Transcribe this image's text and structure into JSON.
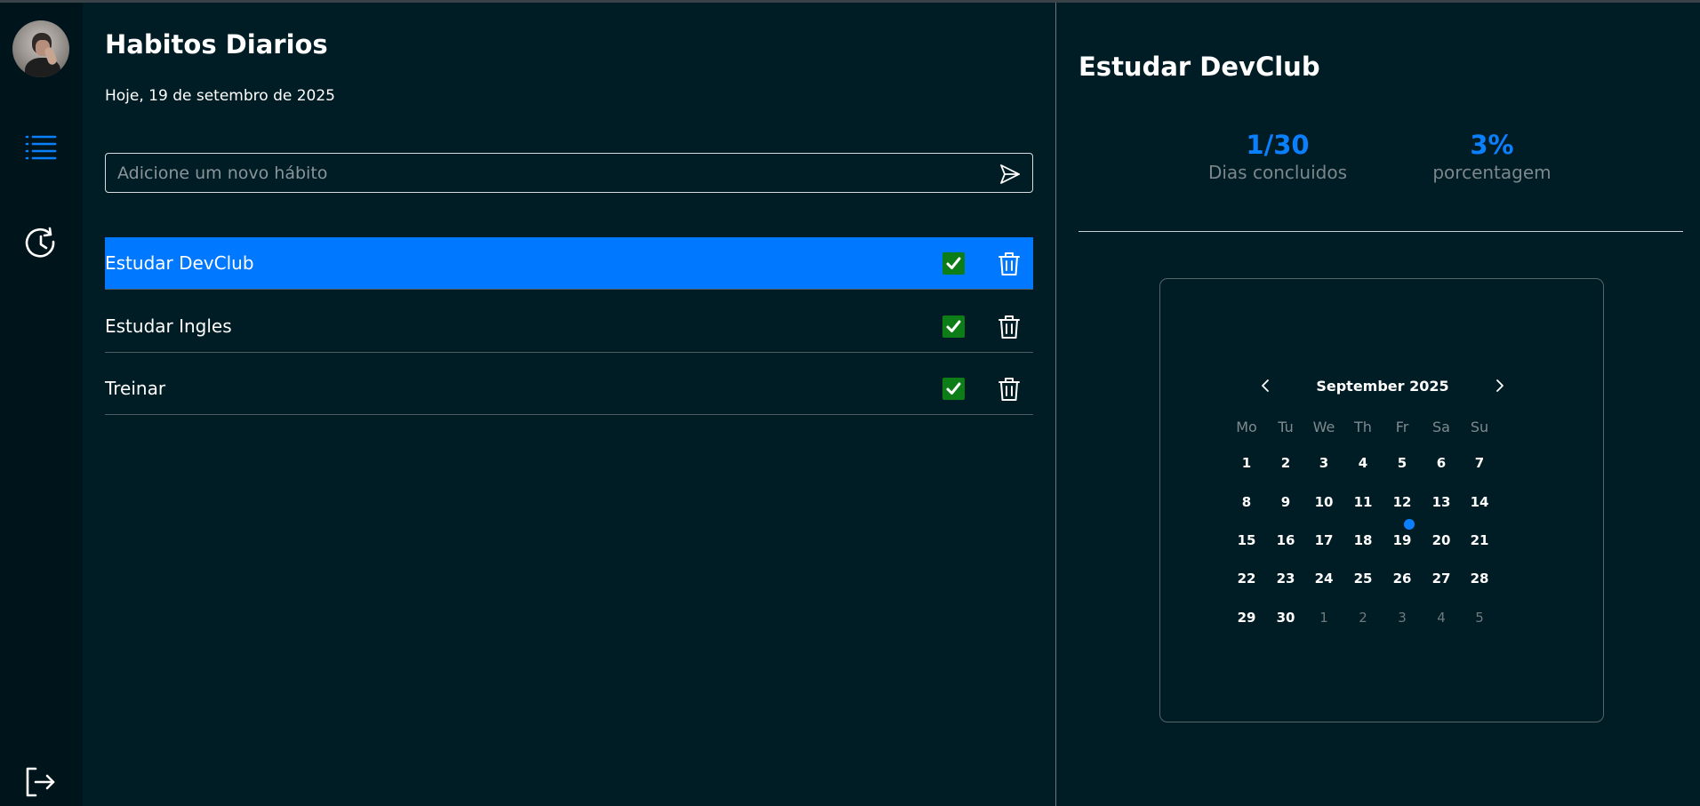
{
  "sidebar": {
    "avatar_alt": "",
    "icons": [
      "list-icon",
      "history-icon",
      "logout-icon"
    ],
    "accent": "#0b80ff"
  },
  "main": {
    "title": "Habitos Diarios",
    "date": "Hoje, 19 de setembro de 2025",
    "input_placeholder": "Adicione um novo hábito",
    "input_value": "",
    "habits": [
      {
        "name": "Estudar DevClub",
        "checked": true,
        "active": true
      },
      {
        "name": "Estudar Ingles",
        "checked": true,
        "active": false
      },
      {
        "name": "Treinar",
        "checked": true,
        "active": false
      }
    ]
  },
  "detail": {
    "title": "Estudar DevClub",
    "stats": [
      {
        "value": "1/30",
        "label": "Dias concluidos"
      },
      {
        "value": "3%",
        "label": "porcentagem"
      }
    ],
    "calendar": {
      "month_label": "September 2025",
      "weekdays": [
        "Mo",
        "Tu",
        "We",
        "Th",
        "Fr",
        "Sa",
        "Su"
      ],
      "weeks": [
        [
          [
            "1",
            0
          ],
          [
            "2",
            0
          ],
          [
            "3",
            0
          ],
          [
            "4",
            0
          ],
          [
            "5",
            0
          ],
          [
            "6",
            0
          ],
          [
            "7",
            0
          ]
        ],
        [
          [
            "8",
            0
          ],
          [
            "9",
            0
          ],
          [
            "10",
            0
          ],
          [
            "11",
            0
          ],
          [
            "12",
            0
          ],
          [
            "13",
            0
          ],
          [
            "14",
            0
          ]
        ],
        [
          [
            "15",
            0
          ],
          [
            "16",
            0
          ],
          [
            "17",
            0
          ],
          [
            "18",
            0
          ],
          [
            "19",
            0
          ],
          [
            "20",
            0
          ],
          [
            "21",
            0
          ]
        ],
        [
          [
            "22",
            0
          ],
          [
            "23",
            0
          ],
          [
            "24",
            0
          ],
          [
            "25",
            0
          ],
          [
            "26",
            0
          ],
          [
            "27",
            0
          ],
          [
            "28",
            0
          ]
        ],
        [
          [
            "29",
            0
          ],
          [
            "30",
            0
          ],
          [
            "1",
            1
          ],
          [
            "2",
            1
          ],
          [
            "3",
            1
          ],
          [
            "4",
            1
          ],
          [
            "5",
            1
          ]
        ]
      ],
      "marked_day": "19"
    }
  },
  "colors": {
    "background": "#001c24",
    "sidebar": "#00141b",
    "active_row": "#0078ff",
    "checkbox": "#0d7d18",
    "stat_value": "#0b80ff"
  }
}
